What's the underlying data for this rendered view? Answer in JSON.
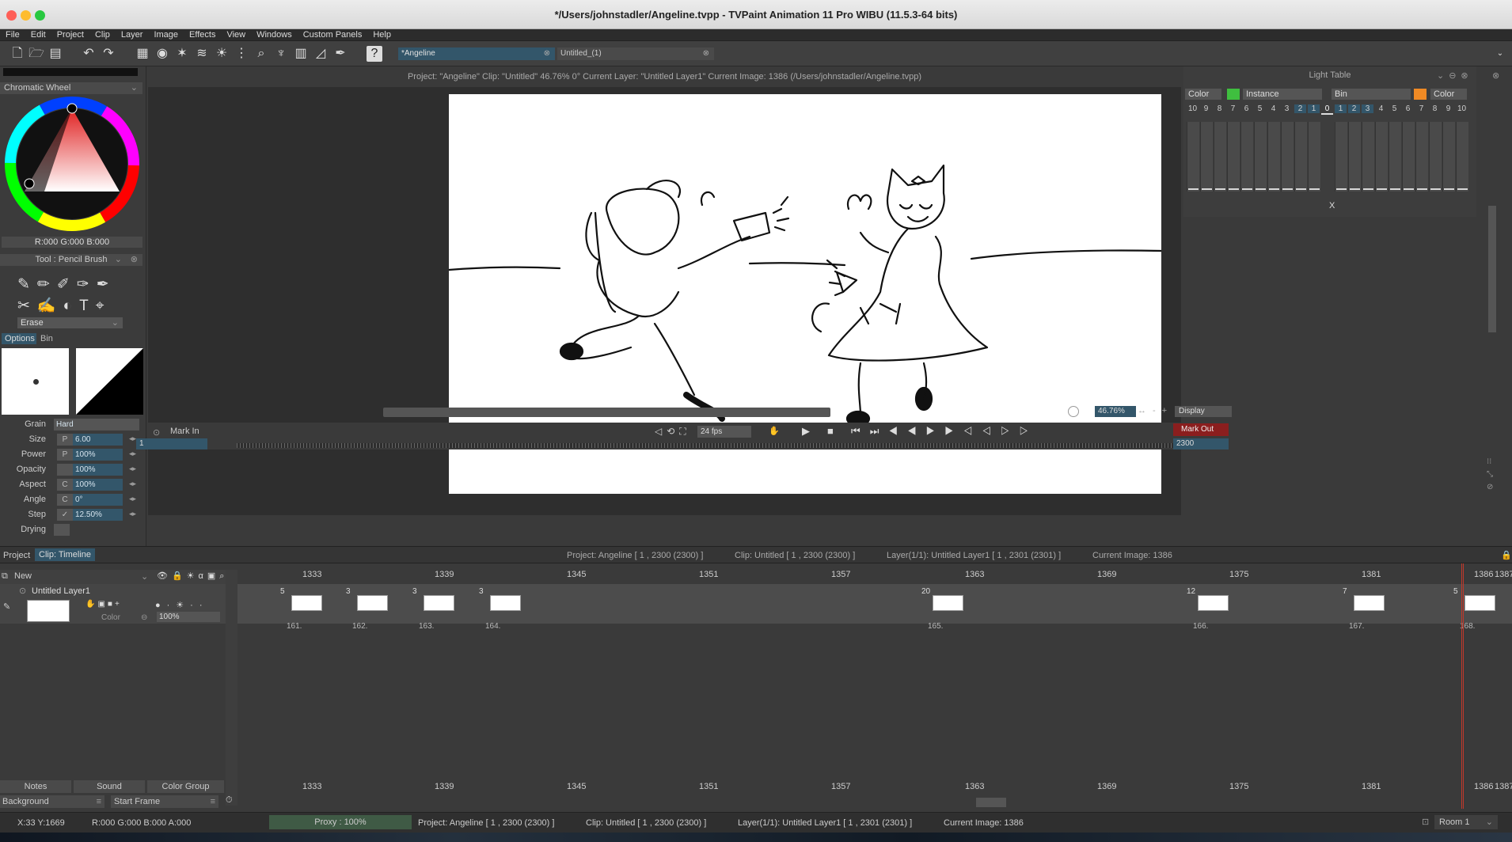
{
  "window": {
    "title": "*/Users/johnstadler/Angeline.tvpp - TVPaint Animation 11 Pro WIBU (11.5.3-64 bits)"
  },
  "menu": [
    "File",
    "Edit",
    "Project",
    "Clip",
    "Layer",
    "Image",
    "Effects",
    "View",
    "Windows",
    "Custom Panels",
    "Help"
  ],
  "tabs": {
    "active": "*Angeline",
    "inactive": "Untitled_(1)"
  },
  "infobar": "Project:  \"Angeline\"  Clip: \"Untitled\"  46.76%   0°  Current Layer: \"Untitled Layer1\"  Current Image: 1386  (/Users/johnstadler/Angeline.tvpp)",
  "color": {
    "panel": "Chromatic Wheel",
    "rgb": "R:000 G:000 B:000"
  },
  "tool": {
    "title": "Tool : Pencil Brush",
    "mode": "Erase",
    "tab_options": "Options",
    "tab_bin": "Bin"
  },
  "props": [
    {
      "label": "Grain",
      "value": "Hard",
      "box": ""
    },
    {
      "label": "Size",
      "value": "6.00",
      "box": "P"
    },
    {
      "label": "Power",
      "value": "100%",
      "box": "P"
    },
    {
      "label": "Opacity",
      "value": "100%",
      "box": ""
    },
    {
      "label": "Aspect",
      "value": "100%",
      "box": "C"
    },
    {
      "label": "Angle",
      "value": "0°",
      "box": "C"
    },
    {
      "label": "Step",
      "value": "12.50%",
      "box": "✓"
    },
    {
      "label": "Drying",
      "value": "",
      "box": ""
    }
  ],
  "playback": {
    "mark_in": "Mark In",
    "mark_out": "Mark Out",
    "fps": "24 fps",
    "start": "1",
    "end": "2300",
    "zoom": "46.76%",
    "display": "Display",
    "cursor": "1386"
  },
  "lighttable": {
    "title": "Light Table",
    "col1": "Color",
    "col2": "Instance",
    "col3": "Bin",
    "col4": "Color",
    "left_nums": [
      "10",
      "9",
      "8",
      "7",
      "6",
      "5",
      "4",
      "3",
      "2",
      "1"
    ],
    "center": "0",
    "right_nums": [
      "1",
      "2",
      "3",
      "4",
      "5",
      "6",
      "7",
      "8",
      "9",
      "10"
    ],
    "x": "X",
    "green": "#3fbf3f",
    "orange": "#f08a24"
  },
  "timeline": {
    "tab_project": "Project",
    "tab_clip": "Clip: Timeline",
    "project": "Project: Angeline [ 1 , 2300  (2300) ]",
    "clip": "Clip: Untitled [ 1 , 2300  (2300) ]",
    "layer": "Layer(1/1): Untitled Layer1 [ 1 , 2301  (2301) ]",
    "current": "Current Image: 1386",
    "new": "New",
    "layer_name": "Untitled Layer1",
    "color_label": "Color",
    "opacity": "100%",
    "ruler": [
      "1333",
      "1339",
      "1345",
      "1351",
      "1357",
      "1363",
      "1369",
      "1375",
      "1381",
      "1386",
      "1387"
    ],
    "exposures": [
      {
        "n": "5",
        "f": "161."
      },
      {
        "n": "3",
        "f": "162."
      },
      {
        "n": "3",
        "f": "163."
      },
      {
        "n": "3",
        "f": "164."
      },
      {
        "n": "20",
        "f": "165."
      },
      {
        "n": "12",
        "f": "166."
      },
      {
        "n": "7",
        "f": "167."
      },
      {
        "n": "5",
        "f": "168."
      }
    ],
    "notes": "Notes",
    "sound": "Sound",
    "color_group": "Color Group",
    "background": "Background",
    "start_frame": "Start Frame"
  },
  "status": {
    "xy": "X:33  Y:1669",
    "rgba": "R:000 G:000 B:000 A:000",
    "proxy": "Proxy : 100%",
    "project": "Project: Angeline [ 1 , 2300  (2300) ]",
    "clip": "Clip: Untitled [ 1 , 2300  (2300) ]",
    "layer": "Layer(1/1): Untitled Layer1 [ 1 , 2301  (2301) ]",
    "current": "Current Image: 1386",
    "room": "Room 1"
  },
  "accent": "#33566a"
}
